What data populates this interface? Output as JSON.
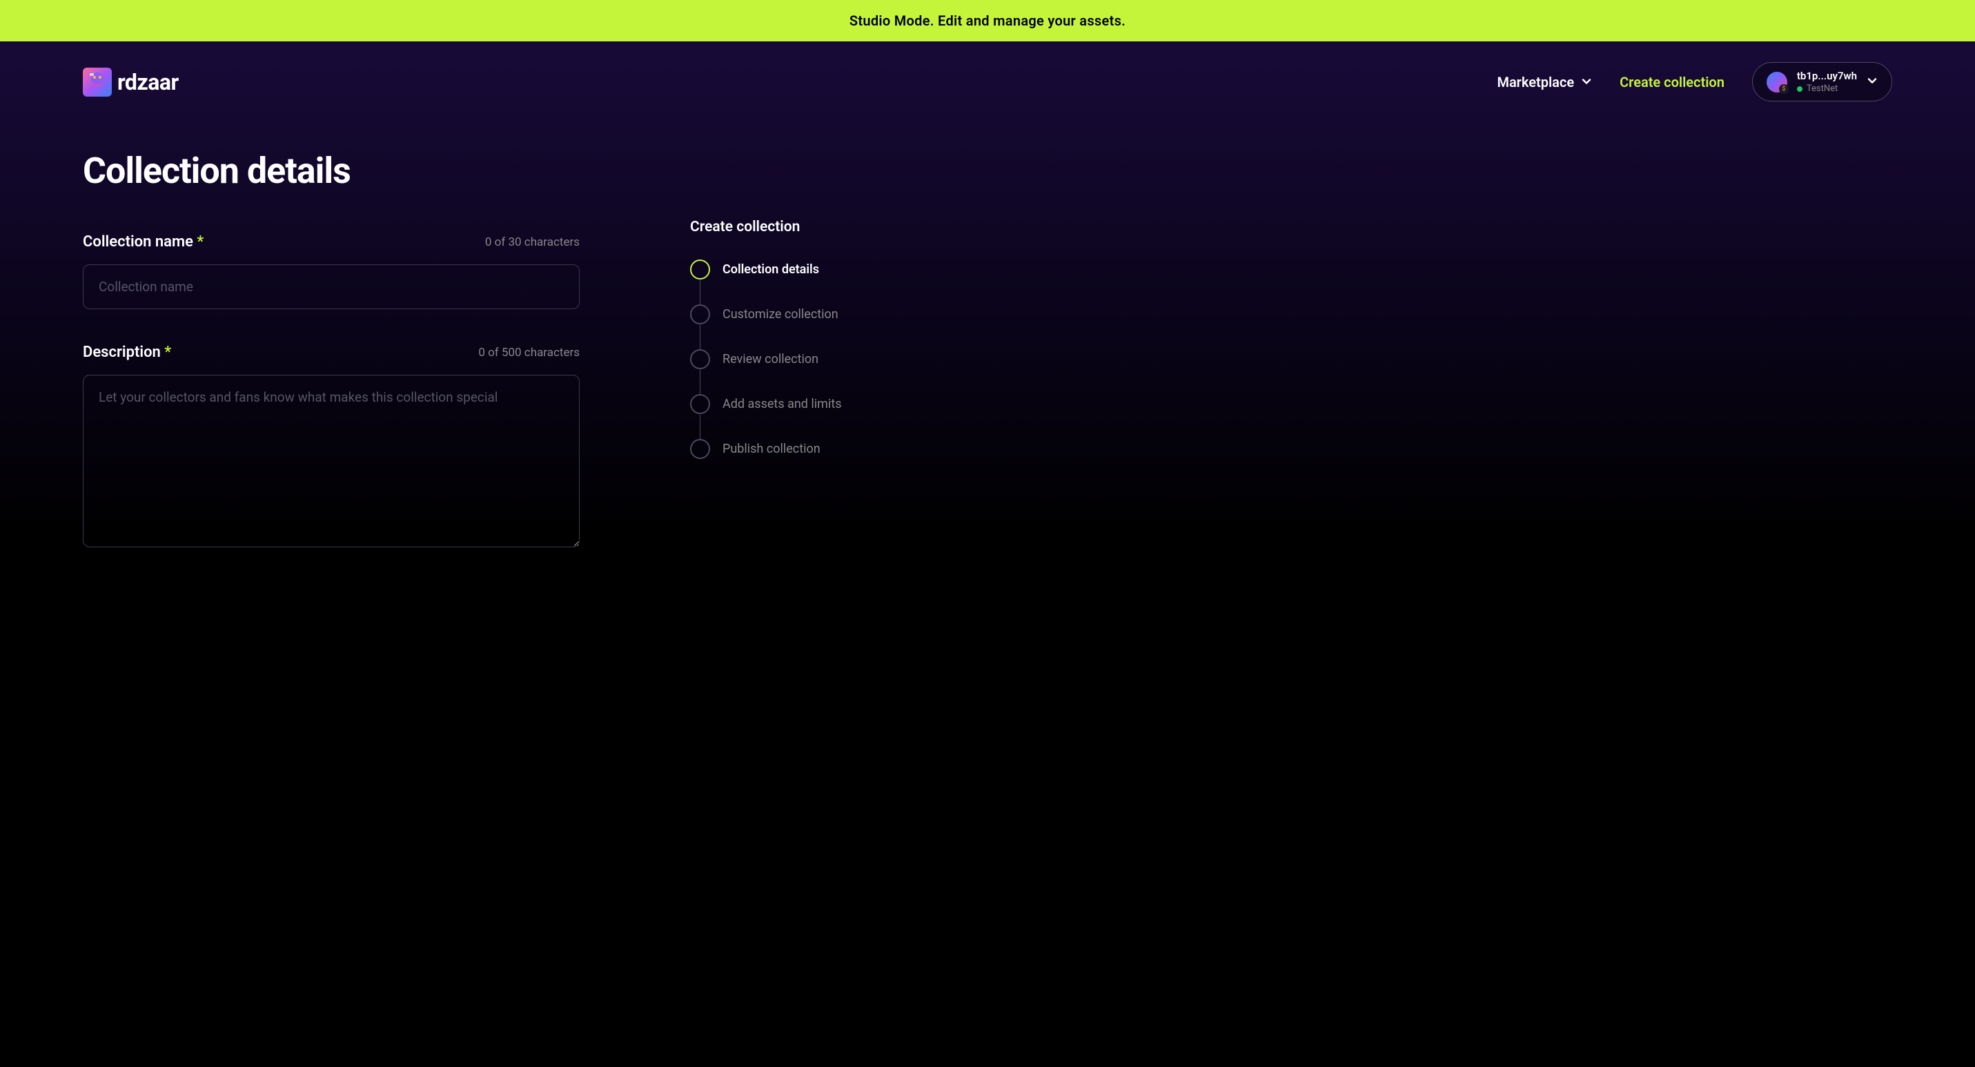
{
  "banner": {
    "text": "Studio Mode. Edit and manage your assets."
  },
  "header": {
    "logo_text": "rdzaar",
    "nav": {
      "marketplace": "Marketplace",
      "create_collection": "Create collection"
    },
    "account": {
      "address": "tb1p...uy7wh",
      "network": "TestNet"
    }
  },
  "page": {
    "title": "Collection details"
  },
  "form": {
    "name": {
      "label": "Collection name",
      "placeholder": "Collection name",
      "counter": "0 of 30 characters"
    },
    "description": {
      "label": "Description",
      "placeholder": "Let your collectors and fans know what makes this collection special",
      "counter": "0 of 500 characters"
    }
  },
  "sidebar": {
    "title": "Create collection",
    "steps": [
      "Collection details",
      "Customize collection",
      "Review collection",
      "Add assets and limits",
      "Publish collection"
    ]
  }
}
